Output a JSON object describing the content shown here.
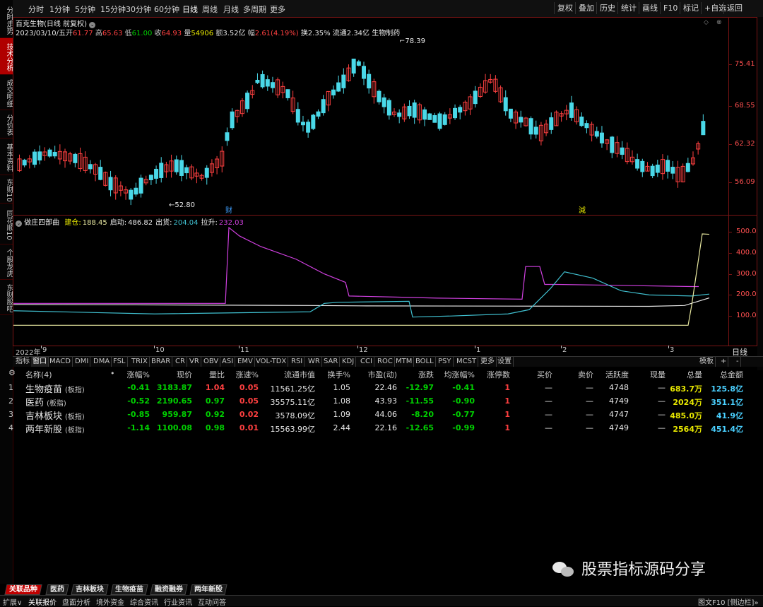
{
  "periods": [
    "分时",
    "1分钟",
    "5分钟",
    "15分钟",
    "30分钟",
    "60分钟",
    "日线",
    "周线",
    "月线",
    "多周期",
    "更多"
  ],
  "active_period": "日线",
  "right_buttons": [
    "复权",
    "叠加",
    "历史",
    "统计",
    "画线",
    "F10",
    "标记",
    "+自选",
    "返回"
  ],
  "left_tabs": [
    "分时走势",
    "技术分析",
    "成交明细",
    "分价表",
    "基本资料",
    "东财10",
    "同花顺10",
    "个股龙虎",
    "东财股吧"
  ],
  "active_left_tab": "技术分析",
  "stock": {
    "title": "百克生物(日线 前复权)",
    "date": "2023/03/10/五",
    "open_label": "开",
    "open": "61.77",
    "high_label": "高",
    "high": "65.63",
    "low_label": "低",
    "low": "61.00",
    "close_label": "收",
    "close": "64.93",
    "vol_label": "量",
    "vol": "54906",
    "amount_label": "额",
    "amount": "3.52亿",
    "chg_label": "幅",
    "chg": "2.61(4.19%)",
    "turnover": "换2.35%",
    "float": "流通2.34亿",
    "sector": "生物制药"
  },
  "main_chart": {
    "price_ticks": [
      "75.41",
      "68.55",
      "62.32",
      "56.09"
    ],
    "max_label": "78.39",
    "min_label": "52.80",
    "markers": [
      "财",
      "減"
    ]
  },
  "indicator": {
    "name": "做庄四部曲",
    "lines": [
      {
        "label": "建仓:",
        "value": "188.45",
        "color": "#e8e8a0"
      },
      {
        "label": "启动:",
        "value": "486.82",
        "color": "#e8e8e8"
      },
      {
        "label": "出货:",
        "value": "204.04",
        "color": "#40c0d0"
      },
      {
        "label": "拉升:",
        "value": "232.03",
        "color": "#d040e0"
      }
    ],
    "ticks": [
      "500.0",
      "400.0",
      "300.0",
      "200.0",
      "100.0"
    ]
  },
  "date_axis": {
    "labels": [
      "2022年",
      "9",
      "10",
      "11",
      "12",
      "1",
      "2",
      "3"
    ],
    "period_label": "日线"
  },
  "indicator_tabs": [
    "指标",
    "窗口",
    "MACD",
    "DMI",
    "DMA",
    "FSL",
    "TRIX",
    "BRAR",
    "CR",
    "VR",
    "OBV",
    "ASI",
    "EMV",
    "VOL-TDX",
    "RSI",
    "WR",
    "SAR",
    "KDJ",
    "CCI",
    "ROC",
    "MTM",
    "BOLL",
    "PSY",
    "MCST",
    "更多",
    "设置"
  ],
  "indicator_tab_right": [
    "模板",
    "+",
    "-"
  ],
  "table": {
    "headers": [
      "名称(4)",
      "•",
      "涨幅%",
      "现价",
      "量比",
      "涨速%",
      "流通市值",
      "换手%",
      "市盈(动)",
      "涨跌",
      "均涨幅%",
      "涨停数",
      "买价",
      "卖价",
      "活跃度",
      "现量",
      "总量",
      "总金额"
    ],
    "rows": [
      {
        "idx": "1",
        "name": "生物疫苗",
        "tag": "(板指)",
        "chg": "-0.41",
        "price": "3183.87",
        "vr": "1.04",
        "spd": "0.05",
        "mv": "11561.25亿",
        "to": "1.05",
        "pe": "22.46",
        "diff": "-12.97",
        "avg": "-0.41",
        "limit": "1",
        "bid": "—",
        "ask": "—",
        "act": "4748",
        "cur": "—",
        "vol": "683.7万",
        "amt": "125.8亿"
      },
      {
        "idx": "2",
        "name": "医药",
        "tag": "(板指)",
        "chg": "-0.52",
        "price": "2190.65",
        "vr": "0.97",
        "spd": "0.05",
        "mv": "35575.11亿",
        "to": "1.08",
        "pe": "43.93",
        "diff": "-11.55",
        "avg": "-0.90",
        "limit": "1",
        "bid": "—",
        "ask": "—",
        "act": "4749",
        "cur": "—",
        "vol": "2024万",
        "amt": "351.1亿"
      },
      {
        "idx": "3",
        "name": "吉林板块",
        "tag": "(板指)",
        "chg": "-0.85",
        "price": "959.87",
        "vr": "0.92",
        "spd": "0.02",
        "mv": "3578.09亿",
        "to": "1.09",
        "pe": "44.06",
        "diff": "-8.20",
        "avg": "-0.77",
        "limit": "1",
        "bid": "—",
        "ask": "—",
        "act": "4747",
        "cur": "—",
        "vol": "485.0万",
        "amt": "41.9亿"
      },
      {
        "idx": "4",
        "name": "两年新股",
        "tag": "(板指)",
        "chg": "-1.14",
        "price": "1100.08",
        "vr": "0.98",
        "spd": "0.01",
        "mv": "15563.99亿",
        "to": "2.44",
        "pe": "22.16",
        "diff": "-12.65",
        "avg": "-0.99",
        "limit": "1",
        "bid": "—",
        "ask": "—",
        "act": "4749",
        "cur": "—",
        "vol": "2564万",
        "amt": "451.4亿"
      }
    ]
  },
  "sector_tabs": [
    "关联品种",
    "医药",
    "吉林板块",
    "生物疫苗",
    "融资融券",
    "两年新股"
  ],
  "status_bar": [
    "扩展∨",
    "关联报价",
    "盘面分析",
    "境外资金",
    "综合资讯",
    "行业资讯",
    "互动问答"
  ],
  "status_right": "图文F10 [侧边栏]»",
  "watermark": "股票指标源码分享",
  "colors": {
    "up": "#ff4040",
    "down": "#4ad8e8",
    "border": "#7a1414"
  }
}
